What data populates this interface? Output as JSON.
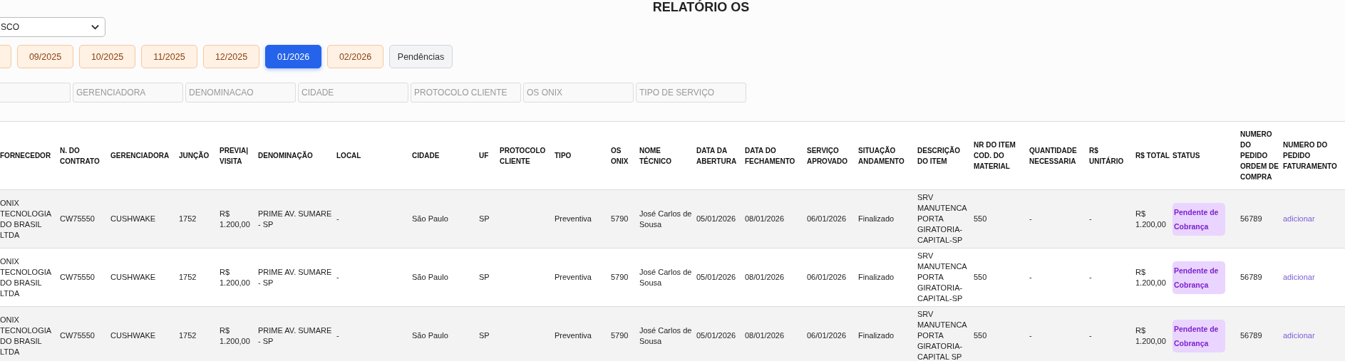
{
  "title": "RELATÓRIO OS",
  "unit_select": {
    "value": "SCO"
  },
  "month_buttons": [
    {
      "selected": false
    },
    {
      "label": "09/2025",
      "selected": false
    },
    {
      "label": "10/2025",
      "selected": false
    },
    {
      "label": "11/2025",
      "selected": false
    },
    {
      "label": "12/2025",
      "selected": false
    },
    {
      "label": "01/2026",
      "selected": true
    },
    {
      "label": "02/2026",
      "selected": false
    }
  ],
  "pending_button": {
    "label": "Pendências"
  },
  "filters": [
    {
      "kind": "cut"
    },
    {
      "placeholder": "GERENCIADORA"
    },
    {
      "placeholder": "DENOMINACAO"
    },
    {
      "placeholder": "CIDADE"
    },
    {
      "placeholder": "PROTOCOLO CLIENTE"
    },
    {
      "placeholder": "OS ONIX"
    },
    {
      "placeholder": "TIPO DE SERVIÇO"
    }
  ],
  "table": {
    "columns": [
      "FORNECEDOR",
      "N. DO CONTRATO",
      "GERENCIADORA",
      "JUNÇÃO",
      "PREVIA| VISITA",
      "DENOMINAÇÃO",
      "LOCAL",
      "CIDADE",
      "UF",
      "PROTOCOLO CLIENTE",
      "TIPO",
      "OS ONIX",
      "NOME TÉCNICO",
      "DATA DA ABERTURA",
      "DATA DO FECHAMENTO",
      "SERVIÇO APROVADO",
      "SITUAÇÃO ANDAMENTO",
      "DESCRIÇÃO DO ITEM",
      "NR DO ITEM COD. DO MATERIAL",
      "QUANTIDADE NECESSARIA",
      "R$ UNITÁRIO",
      "R$ TOTAL",
      "STATUS",
      "NUMERO DO PEDIDO ORDEM DE COMPRA",
      "NUMERO DO PEDIDO FATURAMENTO"
    ],
    "rows": [
      {
        "cells": [
          "ONIX TECNOLOGIA DO BRASIL LTDA",
          "CW75550",
          "CUSHWAKE",
          "1752",
          "R$ 1.200,00",
          "PRIME AV. SUMARE - SP",
          "-",
          "São Paulo",
          "SP",
          "",
          "Preventiva",
          "5790",
          "José Carlos de Sousa",
          "05/01/2026",
          "08/01/2026",
          "06/01/2026",
          "Finalizado",
          "SRV MANUTENCA PORTA GIRATORIA-CAPITAL-SP",
          "550",
          "-",
          "-",
          "R$ 1.200,00"
        ],
        "status": "Pendente de Cobrança",
        "order_number": "56789",
        "invoice_link": "adicionar"
      },
      {
        "cells": [
          "ONIX TECNOLOGIA DO BRASIL LTDA",
          "CW75550",
          "CUSHWAKE",
          "1752",
          "R$ 1.200,00",
          "PRIME AV. SUMARE - SP",
          "-",
          "São Paulo",
          "SP",
          "",
          "Preventiva",
          "5790",
          "José Carlos de Sousa",
          "05/01/2026",
          "08/01/2026",
          "06/01/2026",
          "Finalizado",
          "SRV MANUTENCA PORTA GIRATORIA-CAPITAL-SP",
          "550",
          "-",
          "-",
          "R$ 1.200,00"
        ],
        "status": "Pendente de Cobrança",
        "order_number": "56789",
        "invoice_link": "adicionar"
      },
      {
        "cells": [
          "ONIX TECNOLOGIA DO BRASIL LTDA",
          "CW75550",
          "CUSHWAKE",
          "1752",
          "R$ 1.200,00",
          "PRIME AV. SUMARE - SP",
          "-",
          "São Paulo",
          "SP",
          "",
          "Preventiva",
          "5790",
          "José Carlos de Sousa",
          "05/01/2026",
          "08/01/2026",
          "06/01/2026",
          "Finalizado",
          "SRV MANUTENCA PORTA GIRATORIA-CAPITAL SP",
          "550",
          "-",
          "-",
          "R$ 1.200,00"
        ],
        "status": "Pendente de Cobrança",
        "order_number": "56789",
        "invoice_link": "adicionar"
      }
    ]
  }
}
